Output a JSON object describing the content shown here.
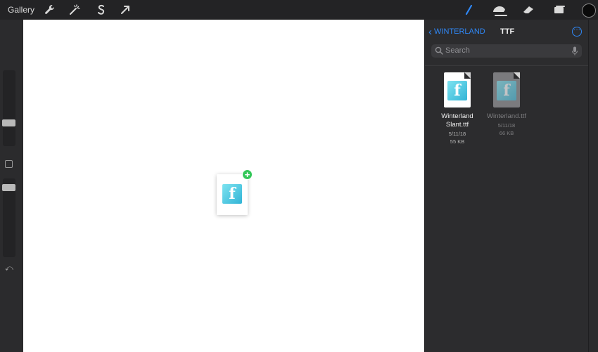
{
  "toolbar": {
    "gallery_label": "Gallery",
    "left_tools": [
      "wrench-icon",
      "magic-wand-icon",
      "selection-s-icon",
      "transform-arrow-icon"
    ],
    "right_tools": [
      "brush-icon",
      "smudge-icon",
      "eraser-icon",
      "layers-icon",
      "color-icon"
    ],
    "accent_color": "#2f87f5"
  },
  "sidebar": {
    "undo_icon": "undo-icon"
  },
  "canvas": {
    "dragged_item_icon": "font-file-icon",
    "badge_symbol": "+"
  },
  "files": {
    "back_label": "WINTERLAND",
    "title": "TTF",
    "more_symbol": "···",
    "search_placeholder": "Search",
    "items": [
      {
        "name_line1": "Winterland",
        "name_line2": "Slant.ttf",
        "date": "5/11/18",
        "size": "55 KB",
        "dimmed": false
      },
      {
        "name_line1": "Winterland.ttf",
        "name_line2": "",
        "date": "5/11/18",
        "size": "66 KB",
        "dimmed": true
      }
    ]
  }
}
